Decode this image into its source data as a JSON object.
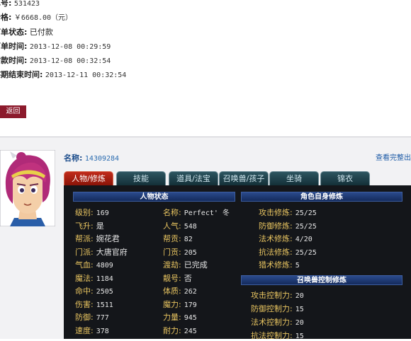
{
  "order": {
    "number": {
      "label": "单号:",
      "value": "531423"
    },
    "price": {
      "label": "价格:",
      "value": "￥6668.00（元）"
    },
    "status": {
      "label": "订单状态:",
      "value": "已付款"
    },
    "order_time": {
      "label": "下单时间:",
      "value": "2013-12-08 00:29:59"
    },
    "pay_time": {
      "label": "付款时间:",
      "value": "2013-12-08 00:32:54"
    },
    "observation_end": {
      "label": "考察期结束时间:",
      "value": "2013-12-11 00:32:54"
    }
  },
  "back_button": "返回",
  "character": {
    "name_label": "名称:",
    "name_value": "14309284",
    "full_info_link": "查看完整出售"
  },
  "tabs": [
    {
      "label": "人物/修炼",
      "active": true
    },
    {
      "label": "技能",
      "active": false
    },
    {
      "label": "道具/法宝",
      "active": false
    },
    {
      "label": "召唤兽/孩子",
      "active": false
    },
    {
      "label": "坐骑",
      "active": false
    },
    {
      "label": "锦衣",
      "active": false
    }
  ],
  "status_section": {
    "title": "人物状态",
    "left": [
      {
        "label": "级别:",
        "value": "169"
      },
      {
        "label": "飞升:",
        "value": "是"
      },
      {
        "label": "帮派:",
        "value": "婉花君"
      },
      {
        "label": "门派:",
        "value": "大唐官府"
      },
      {
        "label": "气血:",
        "value": "4809"
      },
      {
        "label": "魔法:",
        "value": "1184"
      },
      {
        "label": "命中:",
        "value": "2505"
      },
      {
        "label": "伤害:",
        "value": "1511"
      },
      {
        "label": "防御:",
        "value": "777"
      },
      {
        "label": "速度:",
        "value": "378"
      }
    ],
    "right": [
      {
        "label": "名称:",
        "value": "Perfect' 冬"
      },
      {
        "label": "人气:",
        "value": "548"
      },
      {
        "label": "帮贡:",
        "value": "82"
      },
      {
        "label": "门贡:",
        "value": "205"
      },
      {
        "label": "渡劫:",
        "value": "已完成"
      },
      {
        "label": "靓号:",
        "value": "否"
      },
      {
        "label": "体质:",
        "value": "262"
      },
      {
        "label": "魔力:",
        "value": "179"
      },
      {
        "label": "力量:",
        "value": "945"
      },
      {
        "label": "耐力:",
        "value": "245"
      }
    ]
  },
  "cultivation_section": {
    "title": "角色自身修炼",
    "rows": [
      {
        "label": "攻击修炼:",
        "value": "25/25"
      },
      {
        "label": "防御修炼:",
        "value": "25/25"
      },
      {
        "label": "法术修炼:",
        "value": "4/20"
      },
      {
        "label": "抗法修炼:",
        "value": "25/25"
      },
      {
        "label": "猎术修炼:",
        "value": "5"
      }
    ]
  },
  "pet_section": {
    "title": "召唤兽控制修炼",
    "rows": [
      {
        "label": "攻击控制力:",
        "value": "20"
      },
      {
        "label": "防御控制力:",
        "value": "15"
      },
      {
        "label": "法术控制力:",
        "value": "20"
      },
      {
        "label": "抗法控制力:",
        "value": "15"
      }
    ]
  },
  "colors": {
    "accent_red": "#8c1a2c",
    "price_green": "#2a9a2a",
    "panel_bg": "#14161a",
    "stat_label": "#e8c460",
    "header_blue": "#1c3a78"
  }
}
